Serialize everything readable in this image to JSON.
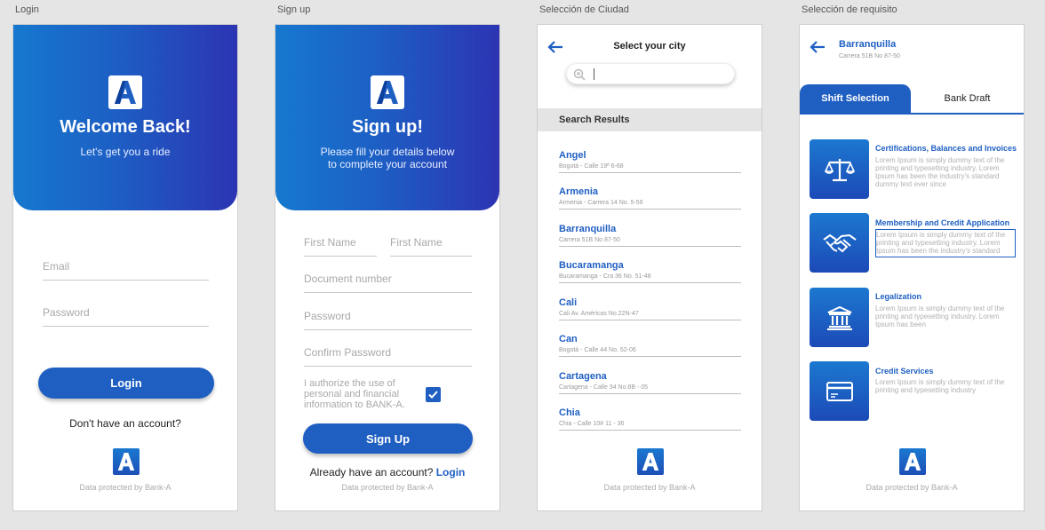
{
  "artboards": [
    "Login",
    "Sign up",
    "Selección de Ciudad",
    "Selección de requisito"
  ],
  "brand": {
    "primary": "#1f5fc2",
    "gradient_start": "#1678cf",
    "gradient_end": "#2c34b3",
    "logo_letter": "A"
  },
  "footer_note": "Data protected by Bank-A",
  "login": {
    "title": "Welcome Back!",
    "subtitle": "Let's get you a ride",
    "email_placeholder": "Email",
    "password_placeholder": "Password",
    "login_button": "Login",
    "no_account": "Don't have an account?"
  },
  "signup": {
    "title": "Sign up!",
    "subtitle_line1": "Please fill your details below",
    "subtitle_line2": "to complete your account",
    "first_name_placeholder": "First Name",
    "second_name_placeholder": "First Name",
    "document_placeholder": "Document number",
    "password_placeholder": "Password",
    "confirm_placeholder": "Confirm Password",
    "authorize_line1": "I authorize the use of",
    "authorize_line2": "personal and financial",
    "authorize_line3": "information to BANK-A.",
    "authorize_checked": true,
    "signup_button": "Sign Up",
    "have_account": "Already have an account?",
    "login_link": "Login"
  },
  "city": {
    "title": "Select your city",
    "search_value": "",
    "results_header": "Search Results",
    "cities": [
      {
        "name": "Angel",
        "address": "Bogotá - Calle 19ª 6-68"
      },
      {
        "name": "Armenia",
        "address": "Armenia - Carrera 14 No. 5-59"
      },
      {
        "name": "Barranquilla",
        "address": "Carrera 51B No 87-50"
      },
      {
        "name": "Bucaramanga",
        "address": "Bucaramanga - Cra 36 No. 51-48"
      },
      {
        "name": "Cali",
        "address": "Cali Av. Américas No.22N-47"
      },
      {
        "name": "Can",
        "address": "Bogotá - Calle 44 No. 52-06"
      },
      {
        "name": "Cartagena",
        "address": "Cartagena - Calle 34 No.8B - 05"
      },
      {
        "name": "Chia",
        "address": "Chia - Calle 10# 11 - 36"
      }
    ]
  },
  "requirement": {
    "city_name": "Barranquilla",
    "city_address": "Carrera 51B No 87-50",
    "tab_active": "Shift Selection",
    "tab_inactive": "Bank Draft",
    "items": [
      {
        "title": "Certifications, Balances and Invoices",
        "icon": "scale-icon",
        "desc": [
          "Lorem Ipsum is simply dummy text of the",
          "printing and typesetting industry. Lorem",
          "Ipsum has been the industry's standard",
          "dummy text ever since"
        ]
      },
      {
        "title": "Membership and Credit Application",
        "icon": "handshake-icon",
        "desc": [
          "Lorem Ipsum is simply dummy text of the",
          "printing and typesetting industry. Lorem",
          "Ipsum has been the industry's standard"
        ]
      },
      {
        "title": "Legalization",
        "icon": "bank-icon",
        "desc": [
          "Lorem Ipsum is simply dummy text of the",
          "printing and typesetting industry. Lorem",
          "Ipsum has been"
        ]
      },
      {
        "title": "Credit Services",
        "icon": "credit-card-icon",
        "desc": [
          "Lorem Ipsum is simply dummy text of the",
          "printing and typesetting industry"
        ]
      }
    ]
  }
}
